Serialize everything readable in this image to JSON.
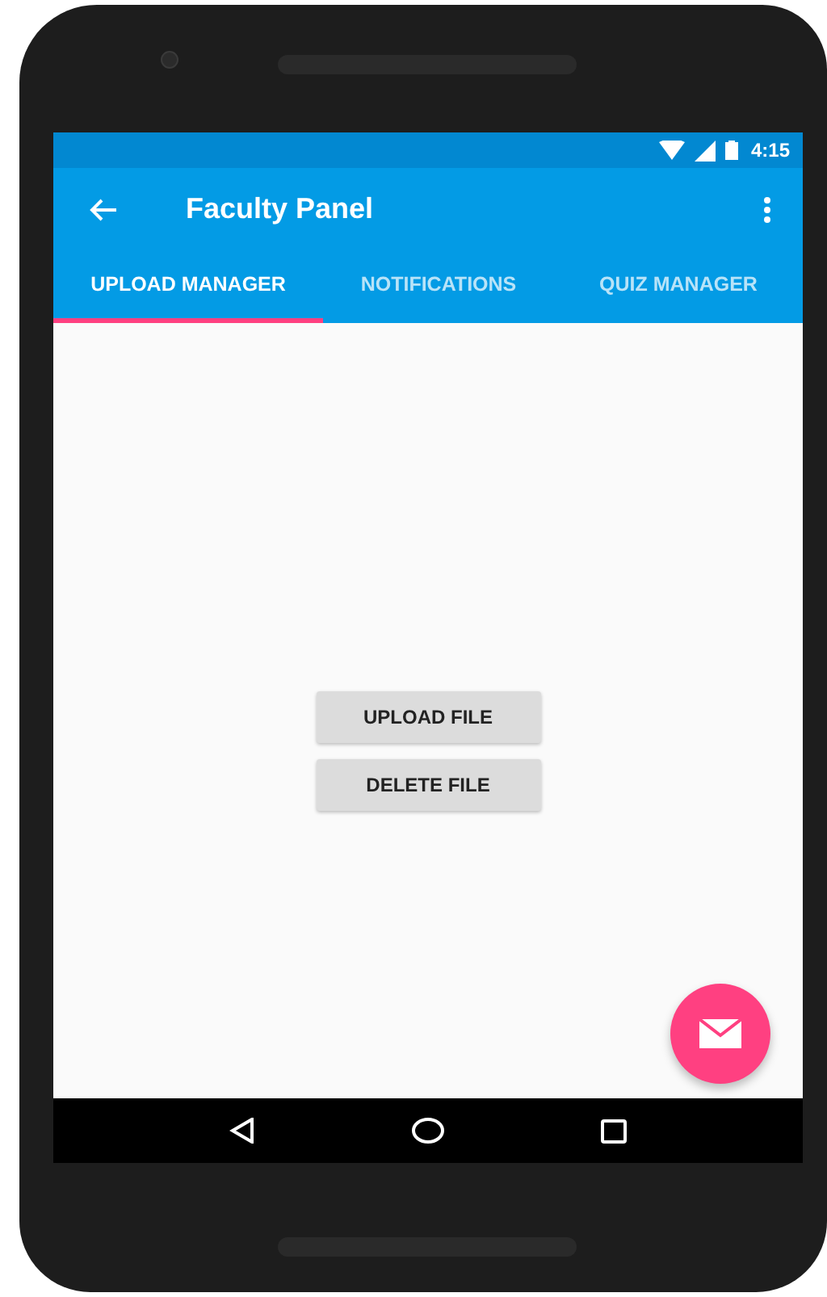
{
  "status_bar": {
    "time": "4:15"
  },
  "toolbar": {
    "title": "Faculty Panel"
  },
  "tabs": [
    {
      "label": "UPLOAD MANAGER",
      "selected": true
    },
    {
      "label": "NOTIFICATIONS",
      "selected": false
    },
    {
      "label": "QUIZ MANAGER",
      "selected": false
    }
  ],
  "buttons": [
    "UPLOAD FILE",
    "DELETE FILE"
  ]
}
